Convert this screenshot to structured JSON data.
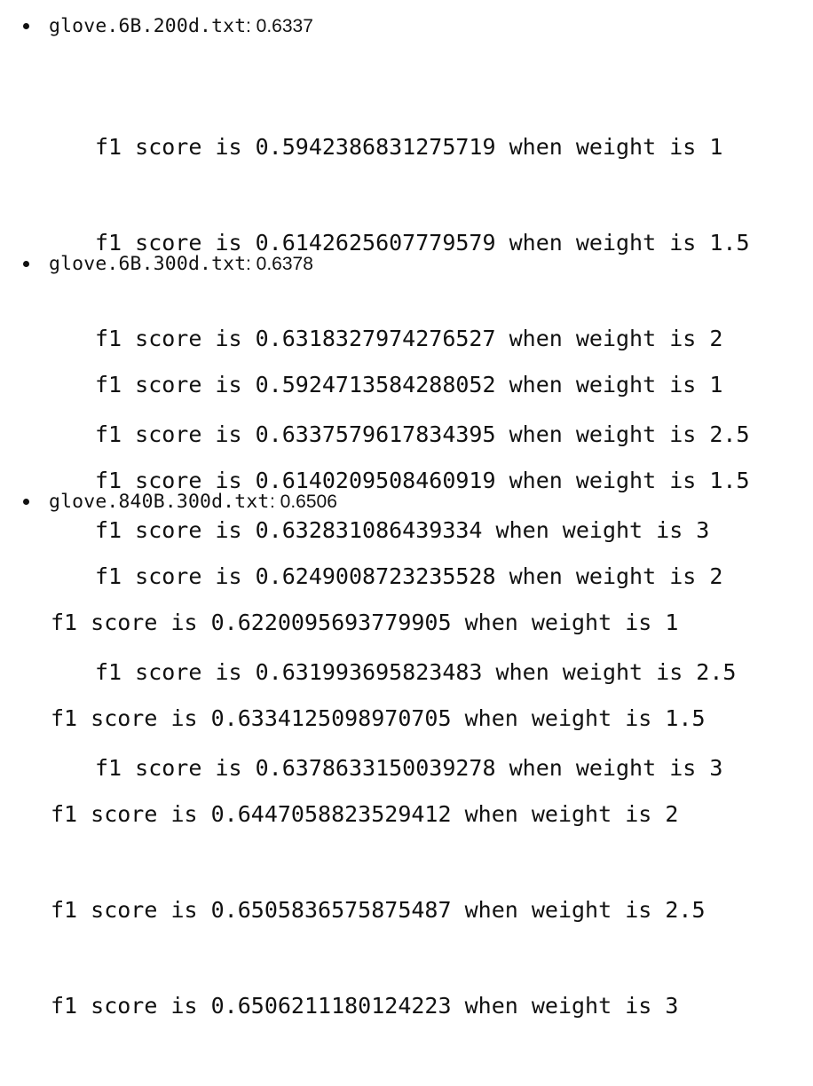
{
  "items": [
    {
      "filename": "glove.6B.200d.txt",
      "best_score": ": 0.6337",
      "lines": [
        "f1 score is 0.5942386831275719 when weight is 1",
        "f1 score is 0.6142625607779579 when weight is 1.5",
        "f1 score is 0.6318327974276527 when weight is 2",
        "f1 score is 0.6337579617834395 when weight is 2.5",
        "f1 score is 0.632831086439334 when weight is 3"
      ]
    },
    {
      "filename": "glove.6B.300d.txt",
      "best_score": ": 0.6378",
      "lines": [
        "f1 score is 0.5924713584288052 when weight is 1",
        "f1 score is 0.6140209508460919 when weight is 1.5",
        "f1 score is 0.6249008723235528 when weight is 2",
        "f1 score is 0.631993695823483 when weight is 2.5",
        "f1 score is 0.6378633150039278 when weight is 3"
      ]
    },
    {
      "filename": "glove.840B.300d.txt",
      "best_score": ": 0.6506",
      "lines": [
        "f1 score is 0.6220095693779905 when weight is 1",
        "f1 score is 0.6334125098970705 when weight is 1.5",
        "f1 score is 0.6447058823529412 when weight is 2",
        "f1 score is 0.6505836575875487 when weight is 2.5",
        "f1 score is 0.6506211180124223 when weight is 3"
      ]
    }
  ]
}
